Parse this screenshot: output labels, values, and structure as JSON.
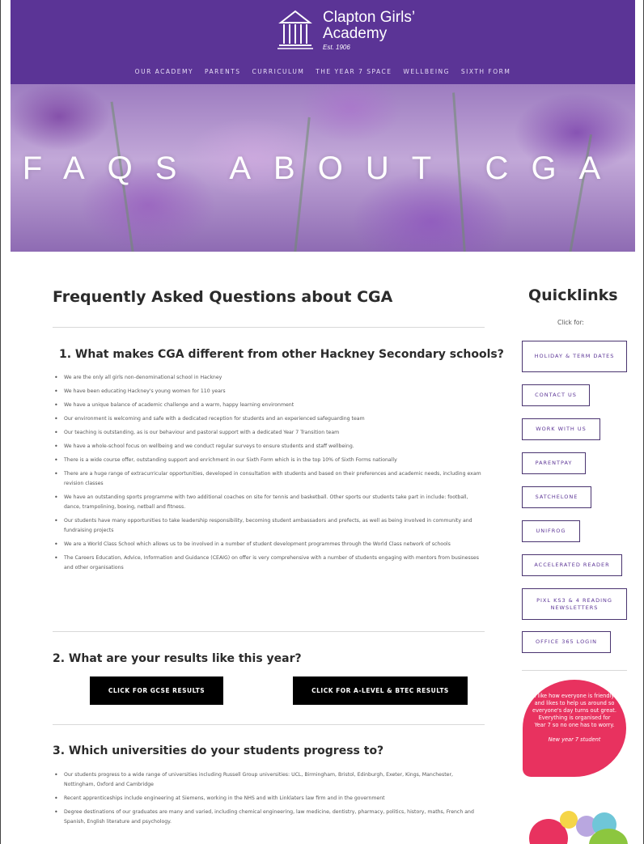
{
  "header": {
    "brand_line1": "Clapton Girls’",
    "brand_line2": "Academy",
    "est": "Est. 1906",
    "nav": [
      "OUR ACADEMY",
      "PARENTS",
      "CURRICULUM",
      "THE YEAR 7 SPACE",
      "WELLBEING",
      "SIXTH FORM"
    ],
    "bg_color": "#5b3496"
  },
  "hero": {
    "title": "FAQS ABOUT CGA"
  },
  "main": {
    "title": "Frequently Asked Questions about CGA",
    "q1": {
      "title": "1. What makes CGA different from other Hackney Secondary schools?",
      "items": [
        "We are the only all girls non-denominational school in Hackney",
        "We have been educating Hackney's young women for 110 years",
        "We have a unique balance of academic challenge and a warm, happy learning environment",
        "Our environment is welcoming and safe with a dedicated reception for students and an experienced safeguarding team",
        "Our teaching is outstanding, as is our behaviour and pastoral support with a dedicated Year 7 Transition team",
        "We have a whole-school focus on wellbeing and we conduct regular surveys to ensure students and staff wellbeing.",
        "There is a wide course offer, outstanding support and enrichment in our Sixth Form which is in the top 10% of Sixth Forms nationally",
        "There are a huge range of extracurricular opportunities, developed in consultation with students and based on their preferences and academic needs, including exam revision classes",
        "We have an outstanding sports programme with two additional coaches on site for tennis and basketball. Other sports our students take part in include: football, dance, trampolining, boxing, netball and fitness.",
        "Our students have many opportunities to take leadership responsibility, becoming student ambassadors and prefects, as well as being involved in community and fundraising projects",
        "We are a World Class School which allows us to be involved in a number of student development programmes through the World Class network of schools",
        "The Careers Education, Advice, Information and Guidance (CEAIG) on offer is very comprehensive with a number of students engaging with mentors from businesses and other organisations"
      ]
    },
    "q2": {
      "title": "2. What are your results like this year?",
      "btn_gcse": "CLICK FOR GCSE RESULTS",
      "btn_alevel": "CLICK FOR A-LEVEL & BTEC RESULTS"
    },
    "q3": {
      "title": "3. Which universities do your students progress to?",
      "items": [
        "Our students progress to a wide range of universities including Russell Group universities: UCL, Birmingham, Bristol, Edinburgh, Exeter, Kings, Manchester, Nottingham, Oxford and Cambridge",
        "Recent apprenticeships include engineering at Siemens, working in the NHS and with Linklaters law firm and in the government",
        "Degree destinations of our graduates are many and varied, including chemical engineering, law medicine, dentistry, pharmacy, politics, history, maths, French and Spanish, English literature and psychology."
      ]
    }
  },
  "sidebar": {
    "title": "Quicklinks",
    "subtitle": "Click for:",
    "links": [
      "HOLIDAY & TERM DATES",
      "CONTACT US",
      "WORK WITH US",
      "PARENTPAY",
      "SATCHELONE",
      "UNIFROG",
      "ACCELERATED READER",
      "PIXL KS3 & 4 READING NEWSLETTERS",
      "OFFICE 365 LOGIN"
    ],
    "quote": "I like how everyone is friendly and likes to help us around so everyone's day turns out great. Everything is organised for Year 7 so no one has to worry.",
    "quote_attrib": "New year 7 student",
    "quote_color": "#e8325f"
  }
}
